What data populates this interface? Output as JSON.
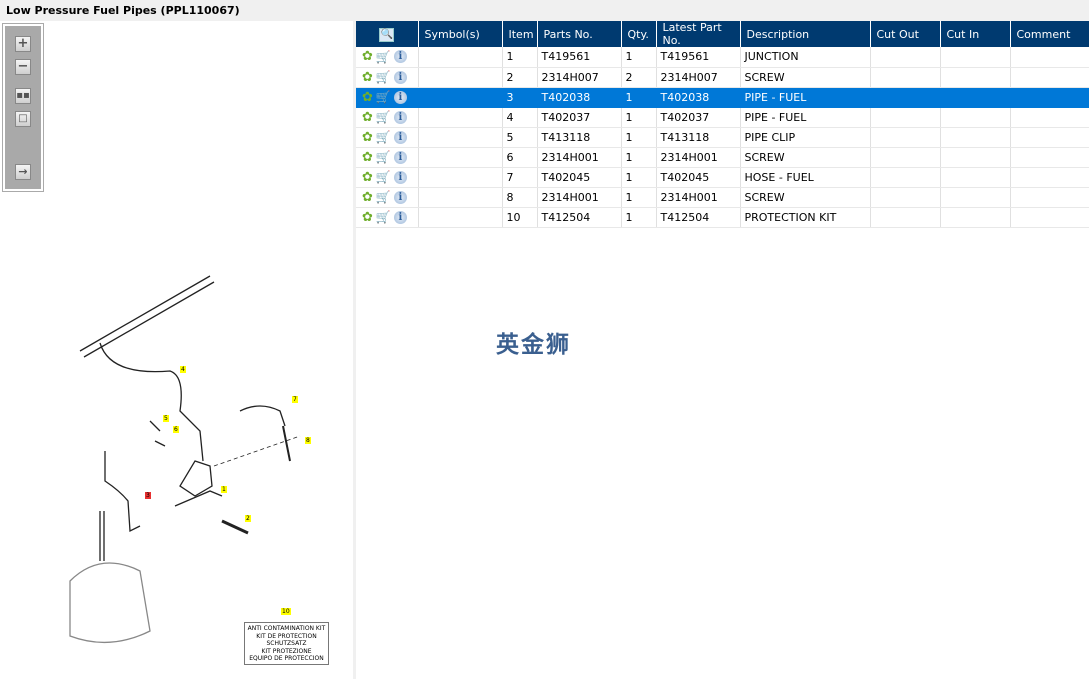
{
  "title": "Low Pressure Fuel Pipes (PPL110067)",
  "toolbar": [
    "zoom-in",
    "zoom-out",
    "fit-all",
    "actual-size",
    "export"
  ],
  "table": {
    "headers": [
      "Symbol(s)",
      "Item",
      "Parts No.",
      "Qty.",
      "Latest Part No.",
      "Description",
      "Cut Out",
      "Cut In",
      "Comment"
    ],
    "rows": [
      {
        "item": "1",
        "part": "T419561",
        "qty": "1",
        "latest": "T419561",
        "desc": "JUNCTION"
      },
      {
        "item": "2",
        "part": "2314H007",
        "qty": "2",
        "latest": "2314H007",
        "desc": "SCREW"
      },
      {
        "item": "3",
        "part": "T402038",
        "qty": "1",
        "latest": "T402038",
        "desc": "PIPE - FUEL"
      },
      {
        "item": "4",
        "part": "T402037",
        "qty": "1",
        "latest": "T402037",
        "desc": "PIPE - FUEL"
      },
      {
        "item": "5",
        "part": "T413118",
        "qty": "1",
        "latest": "T413118",
        "desc": "PIPE CLIP"
      },
      {
        "item": "6",
        "part": "2314H001",
        "qty": "1",
        "latest": "2314H001",
        "desc": "SCREW"
      },
      {
        "item": "7",
        "part": "T402045",
        "qty": "1",
        "latest": "T402045",
        "desc": "HOSE - FUEL"
      },
      {
        "item": "8",
        "part": "2314H001",
        "qty": "1",
        "latest": "2314H001",
        "desc": "SCREW"
      },
      {
        "item": "10",
        "part": "T412504",
        "qty": "1",
        "latest": "T412504",
        "desc": "PROTECTION KIT"
      }
    ],
    "selected_index": 2
  },
  "watermark": "英金狮",
  "diagram": {
    "callouts": [
      "4",
      "7",
      "5",
      "6",
      "8",
      "1",
      "3",
      "2",
      "10"
    ],
    "kit_lines": [
      "ANTI CONTAMINATION KIT",
      "KIT DE PROTECTION",
      "SCHUTZSATZ",
      "KIT PROTEZIONE",
      "EQUIPO DE PROTECCION"
    ]
  }
}
